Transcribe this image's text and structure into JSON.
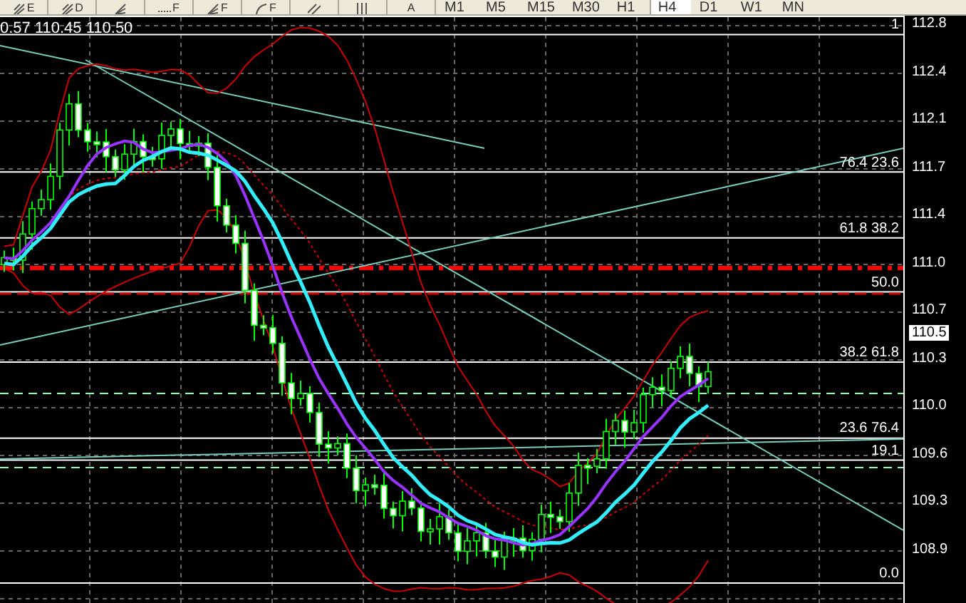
{
  "toolbar": {
    "tools": [
      {
        "kind": "fork",
        "letter": "E"
      },
      {
        "kind": "fork",
        "letter": "D"
      },
      {
        "kind": "fan"
      },
      {
        "kind": "level",
        "letter": "F"
      },
      {
        "kind": "fan",
        "letter": "F"
      },
      {
        "kind": "arc",
        "letter": "F"
      },
      {
        "kind": "lines"
      },
      {
        "kind": "bars"
      },
      {
        "kind": "text",
        "letter": "A"
      }
    ],
    "timeframes": [
      {
        "label": "M1",
        "selected": false
      },
      {
        "label": "M5",
        "selected": false
      },
      {
        "label": "M15",
        "selected": false
      },
      {
        "label": "M30",
        "selected": false
      },
      {
        "label": "H1",
        "selected": false
      },
      {
        "label": "H4",
        "selected": true
      },
      {
        "label": "D1",
        "selected": false
      },
      {
        "label": "W1",
        "selected": false
      },
      {
        "label": "MN",
        "selected": false
      }
    ]
  },
  "chart": {
    "header": "0.57 110.45 110.50",
    "fib_levels": [
      {
        "label": "1"
      },
      {
        "label": "76.4 23.6"
      },
      {
        "label": "61.8 38.2"
      },
      {
        "label": "50.0"
      },
      {
        "label": "38.2 61.8"
      },
      {
        "label": "23.6 76.4"
      },
      {
        "label": "19.1"
      },
      {
        "label": "0.0"
      }
    ],
    "price_axis": [
      {
        "label": "112.8",
        "current": false
      },
      {
        "label": "112.4",
        "current": false
      },
      {
        "label": "112.1",
        "current": false
      },
      {
        "label": "111.7",
        "current": false
      },
      {
        "label": "111.4",
        "current": false
      },
      {
        "label": "111.0",
        "current": false
      },
      {
        "label": "110.7",
        "current": false
      },
      {
        "label": "110.5",
        "current": true
      },
      {
        "label": "110.3",
        "current": false
      },
      {
        "label": "110.0",
        "current": false
      },
      {
        "label": "109.6",
        "current": false
      },
      {
        "label": "109.3",
        "current": false
      },
      {
        "label": "108.9",
        "current": false
      }
    ]
  }
}
